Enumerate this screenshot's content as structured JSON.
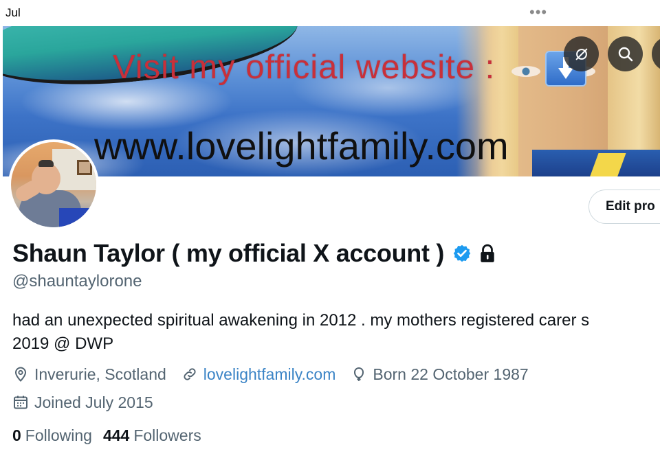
{
  "status_bar": {
    "time": "Jul",
    "more_icon": "more-dots-icon"
  },
  "banner": {
    "line1": "Visit my official website :",
    "line2": "www.lovelightfamily.com",
    "buttons": [
      {
        "icon": "grok-icon"
      },
      {
        "icon": "search-icon"
      }
    ]
  },
  "profile": {
    "display_name": "Shaun Taylor ( my official X account )",
    "handle": "@shauntaylorone",
    "edit_label": "Edit profile",
    "edit_label_visible": "Edit pro",
    "bio_line1": "had an unexpected spiritual awakening in 2012 . my mothers registered carer s",
    "bio_line2": "2019 @ DWP",
    "location": "Inverurie, Scotland",
    "website": "lovelightfamily.com",
    "birthday": "Born 22 October 1987",
    "joined": "Joined July 2015",
    "following_count": "0",
    "following_label": "Following",
    "followers_count": "444",
    "followers_label": "Followers"
  },
  "colors": {
    "verified": "#1d9bf0",
    "link": "#3b84c6",
    "secondary_text": "#536471",
    "banner_red": "#c8303a"
  }
}
